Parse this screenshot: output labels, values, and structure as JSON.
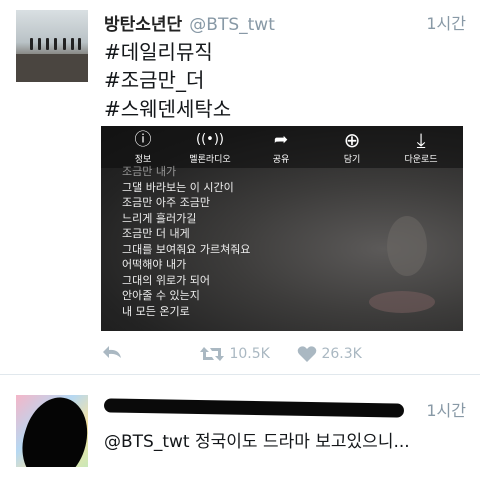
{
  "tweet1": {
    "name": "방탄소년단",
    "handle": "@BTS_twt",
    "time": "1시간",
    "hashtags": [
      "#데일리뮤직",
      "#조금만_더",
      "#스웨덴세탁소"
    ],
    "media": {
      "toolbar": [
        {
          "icon": "info-icon",
          "glyph": "ⓘ",
          "label": "정보"
        },
        {
          "icon": "radio-icon",
          "glyph": "((•))",
          "label": "멜론라디오"
        },
        {
          "icon": "share-icon",
          "glyph": "➦",
          "label": "공유"
        },
        {
          "icon": "add-icon",
          "glyph": "⊕",
          "label": "담기"
        },
        {
          "icon": "download-icon",
          "glyph": "⤓",
          "label": "다운로드"
        }
      ],
      "lyrics": [
        "조금만 내가",
        "그댈 바라보는 이 시간이",
        "조금만 아주 조금만",
        "느리게 흘러가길",
        "조금만 더 내게",
        "그대를 보여줘요 가르쳐줘요",
        "어떡해야 내가",
        "그대의 위로가 되어",
        "안아줄 수 있는지",
        "내 모든 온기로"
      ]
    },
    "actions": {
      "reply_icon": "reply-icon",
      "retweet_icon": "retweet-icon",
      "retweets": "10.5K",
      "like_icon": "heart-icon",
      "likes": "26.3K"
    }
  },
  "tweet2": {
    "time": "1시간",
    "reply_text": "@BTS_twt 정국이도 드라마 보고있으니..."
  }
}
